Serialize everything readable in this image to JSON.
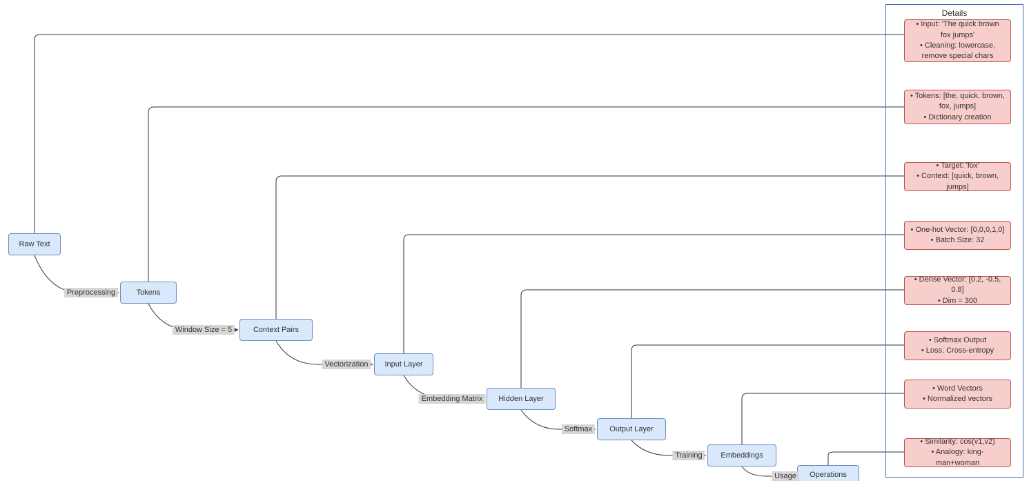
{
  "panel": {
    "title": "Details"
  },
  "nodes": {
    "raw_text": "Raw Text",
    "tokens": "Tokens",
    "context_pairs": "Context Pairs",
    "input_layer": "Input Layer",
    "hidden_layer": "Hidden Layer",
    "output_layer": "Output Layer",
    "embeddings": "Embeddings",
    "operations": "Operations"
  },
  "edges": {
    "preprocessing": "Preprocessing",
    "window": "Window Size = 5",
    "vectorization": "Vectorization",
    "embed_matrix": "Embedding Matrix",
    "softmax": "Softmax",
    "training": "Training",
    "usage": "Usage"
  },
  "details": {
    "d0": {
      "l1": "Input: 'The quick brown fox jumps'",
      "l2": "Cleaning: lowercase, remove special chars"
    },
    "d1": {
      "l1": "Tokens: [the, quick, brown, fox, jumps]",
      "l2": "Dictionary creation"
    },
    "d2": {
      "l1": "Target: 'fox'",
      "l2": "Context: [quick, brown, jumps]"
    },
    "d3": {
      "l1": "One-hot Vector: [0,0,0,1,0]",
      "l2": "Batch Size: 32"
    },
    "d4": {
      "l1": "Dense Vector: [0.2, -0.5, 0.8]",
      "l2": "Dim = 300"
    },
    "d5": {
      "l1": "Softmax Output",
      "l2": "Loss: Cross-entropy"
    },
    "d6": {
      "l1": "Word Vectors",
      "l2": "Normalized vectors"
    },
    "d7": {
      "l1": "Similarity: cos(v1,v2)",
      "l2": "Analogy: king-man+woman"
    }
  }
}
